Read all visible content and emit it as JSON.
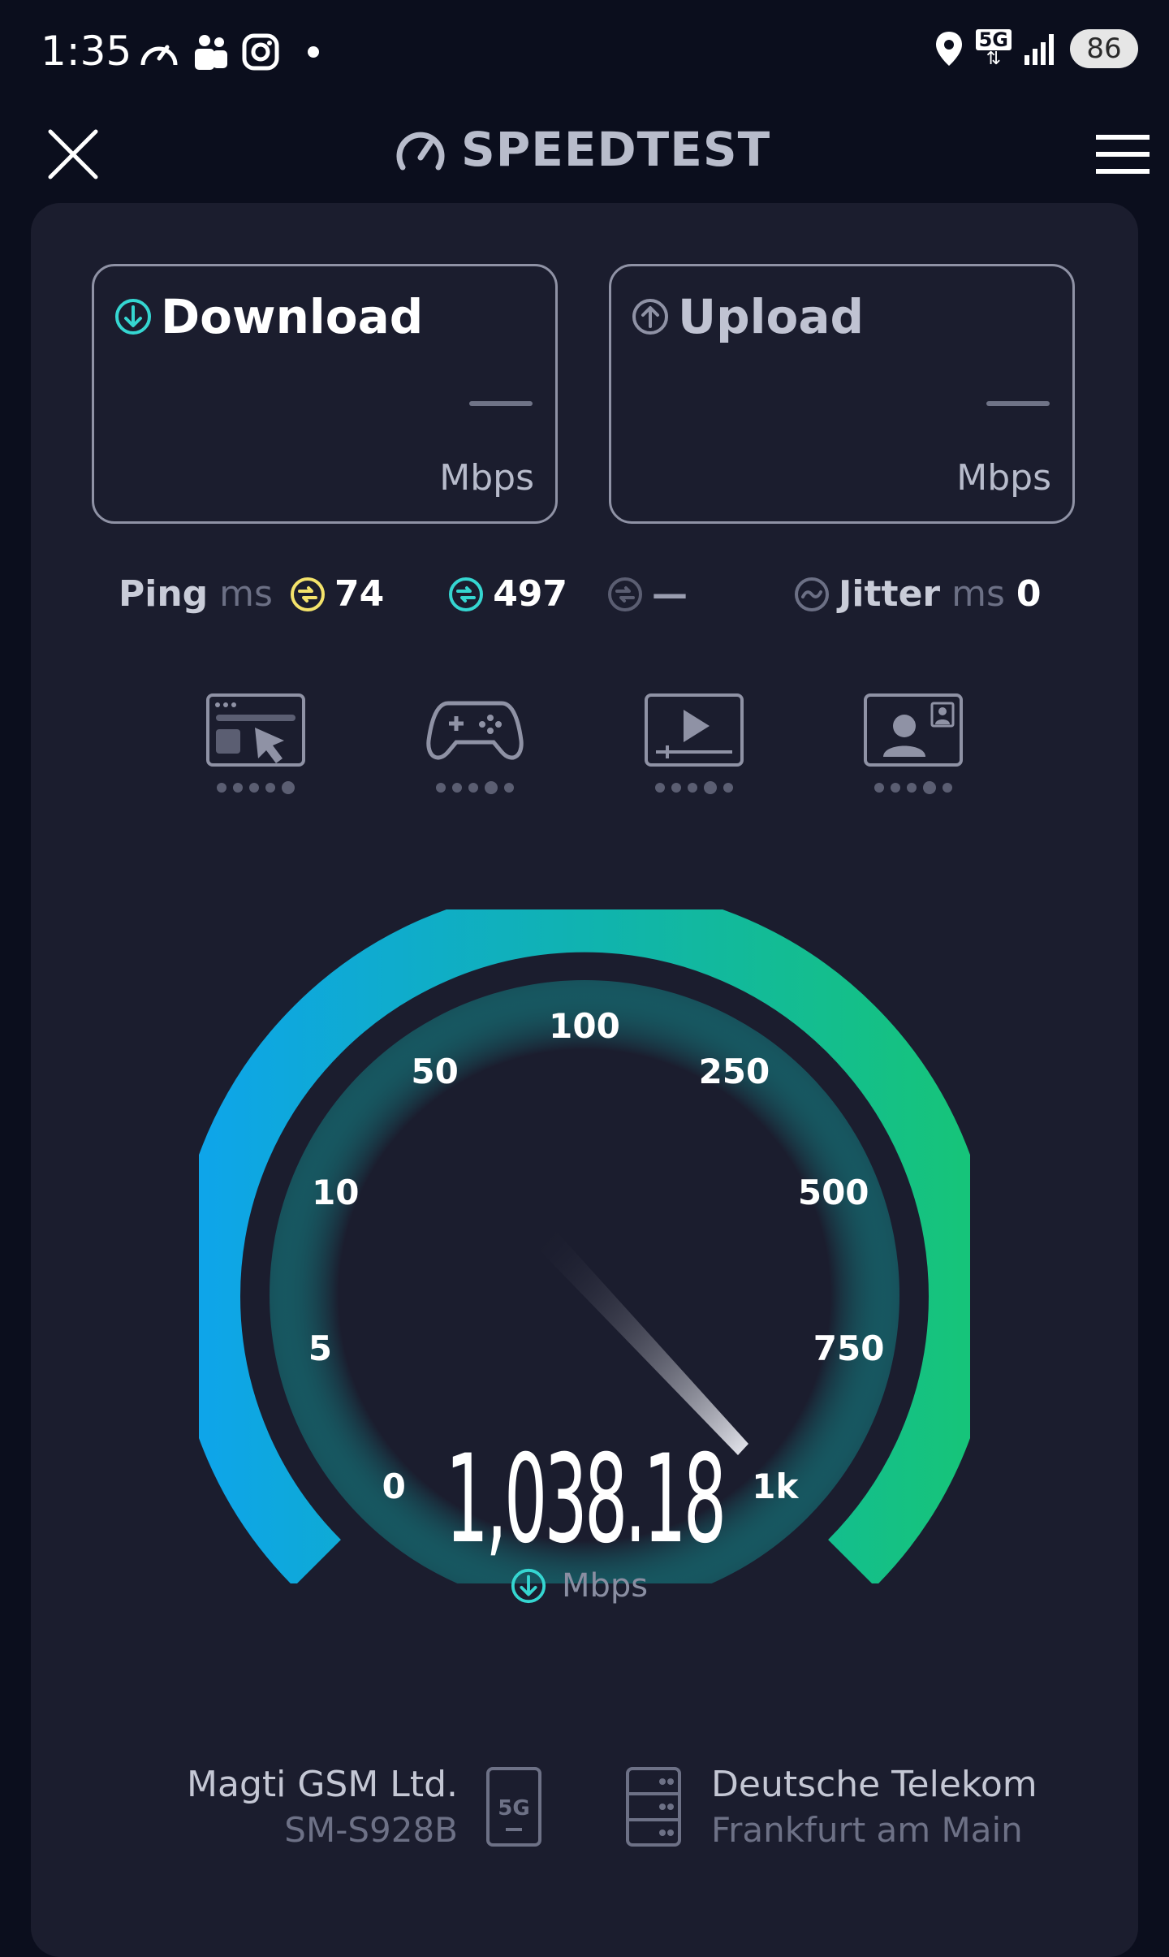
{
  "status_bar": {
    "time": "1:35",
    "network": "5G",
    "battery": "86",
    "icons_left": [
      "speedometer-icon",
      "teams-icon",
      "instagram-icon",
      "dot-icon"
    ],
    "icons_right": [
      "location-icon",
      "5g-icon",
      "signal-icon",
      "battery-icon"
    ]
  },
  "app_bar": {
    "title": "SPEEDTEST",
    "close_icon": "close-icon",
    "menu_icon": "hamburger-menu-icon"
  },
  "cards": {
    "download": {
      "title": "Download",
      "value": "—",
      "unit": "Mbps"
    },
    "upload": {
      "title": "Upload",
      "value": "—",
      "unit": "Mbps"
    }
  },
  "ping": {
    "label": "Ping",
    "unit": "ms",
    "idle": "74",
    "download": "497",
    "upload": "—",
    "jitter_label": "Jitter",
    "jitter_unit": "ms",
    "jitter": "0"
  },
  "activities": [
    {
      "icon": "web-browsing-icon",
      "rating": 5
    },
    {
      "icon": "gaming-icon",
      "rating": 5
    },
    {
      "icon": "video-streaming-icon",
      "rating": 5
    },
    {
      "icon": "video-call-icon",
      "rating": 5
    }
  ],
  "gauge": {
    "ticks": [
      "0",
      "5",
      "10",
      "50",
      "100",
      "250",
      "500",
      "750",
      "1k"
    ],
    "value": "1,038.18",
    "unit": "Mbps",
    "colors": {
      "start": "#0ea5e9",
      "end": "#16c47a"
    }
  },
  "provider": {
    "name": "Magti GSM Ltd.",
    "device": "SM-S928B",
    "network_badge": "5G"
  },
  "server": {
    "name": "Deutsche Telekom",
    "city": "Frankfurt am Main"
  }
}
